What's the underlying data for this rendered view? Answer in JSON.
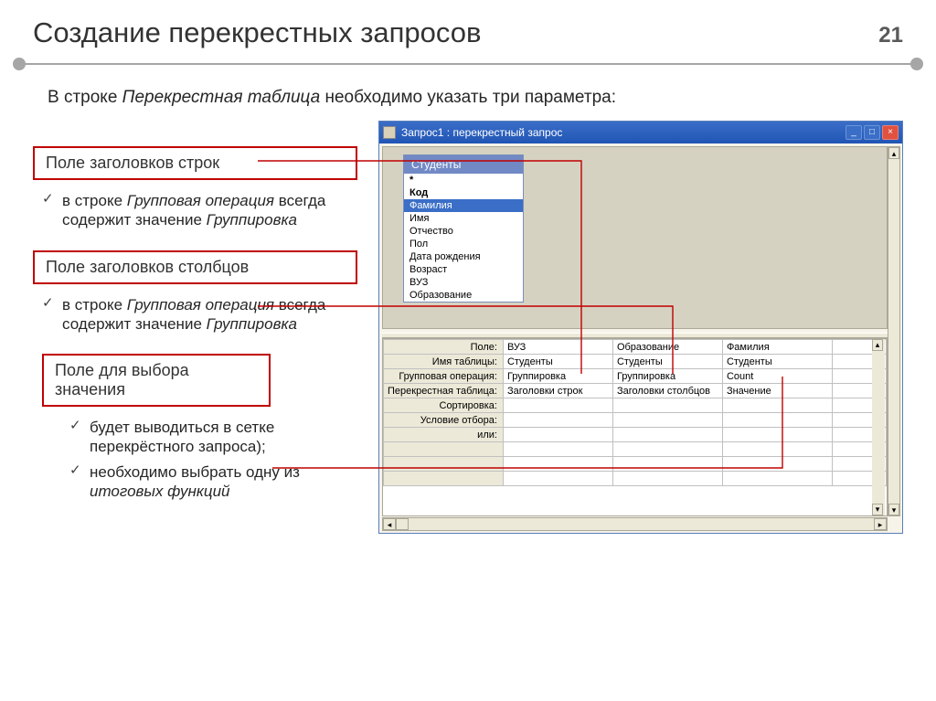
{
  "slide": {
    "title": "Создание перекрестных запросов",
    "number": "21",
    "intro_prefix": "В строке ",
    "intro_italic": "Перекрестная таблица",
    "intro_suffix": " необходимо указать три параметра:"
  },
  "boxes": {
    "row_headers": "Поле заголовков строк",
    "col_headers": "Поле заголовков столбцов",
    "value_field": "Поле для выбора значения"
  },
  "bullets": {
    "b1_prefix": "в строке ",
    "b1_italic1": "Групповая операция",
    "b1_mid": " всегда содержит значение ",
    "b1_italic2": "Группировка",
    "b2_prefix": "в строке ",
    "b2_italic1": "Групповая операция",
    "b2_mid": " всегда содержит значение ",
    "b2_italic2": "Группировка",
    "b3": "будет выводиться в сетке перекрёстного запроса);",
    "b4_prefix": "необходимо выбрать одну из ",
    "b4_italic": "итоговых функций"
  },
  "window": {
    "title": "Запрос1 : перекрестный запрос",
    "table_name": "Студенты",
    "fields": [
      "*",
      "Код",
      "Фамилия",
      "Имя",
      "Отчество",
      "Пол",
      "Дата рождения",
      "Возраст",
      "ВУЗ",
      "Образование"
    ],
    "selected_field_index": 2,
    "grid_labels": [
      "Поле:",
      "Имя таблицы:",
      "Групповая операция:",
      "Перекрестная таблица:",
      "Сортировка:",
      "Условие отбора:",
      "или:"
    ],
    "grid_cols": [
      {
        "field": "ВУЗ",
        "table": "Студенты",
        "op": "Группировка",
        "cross": "Заголовки строк"
      },
      {
        "field": "Образование",
        "table": "Студенты",
        "op": "Группировка",
        "cross": "Заголовки столбцов"
      },
      {
        "field": "Фамилия",
        "table": "Студенты",
        "op": "Count",
        "cross": "Значение"
      }
    ]
  }
}
